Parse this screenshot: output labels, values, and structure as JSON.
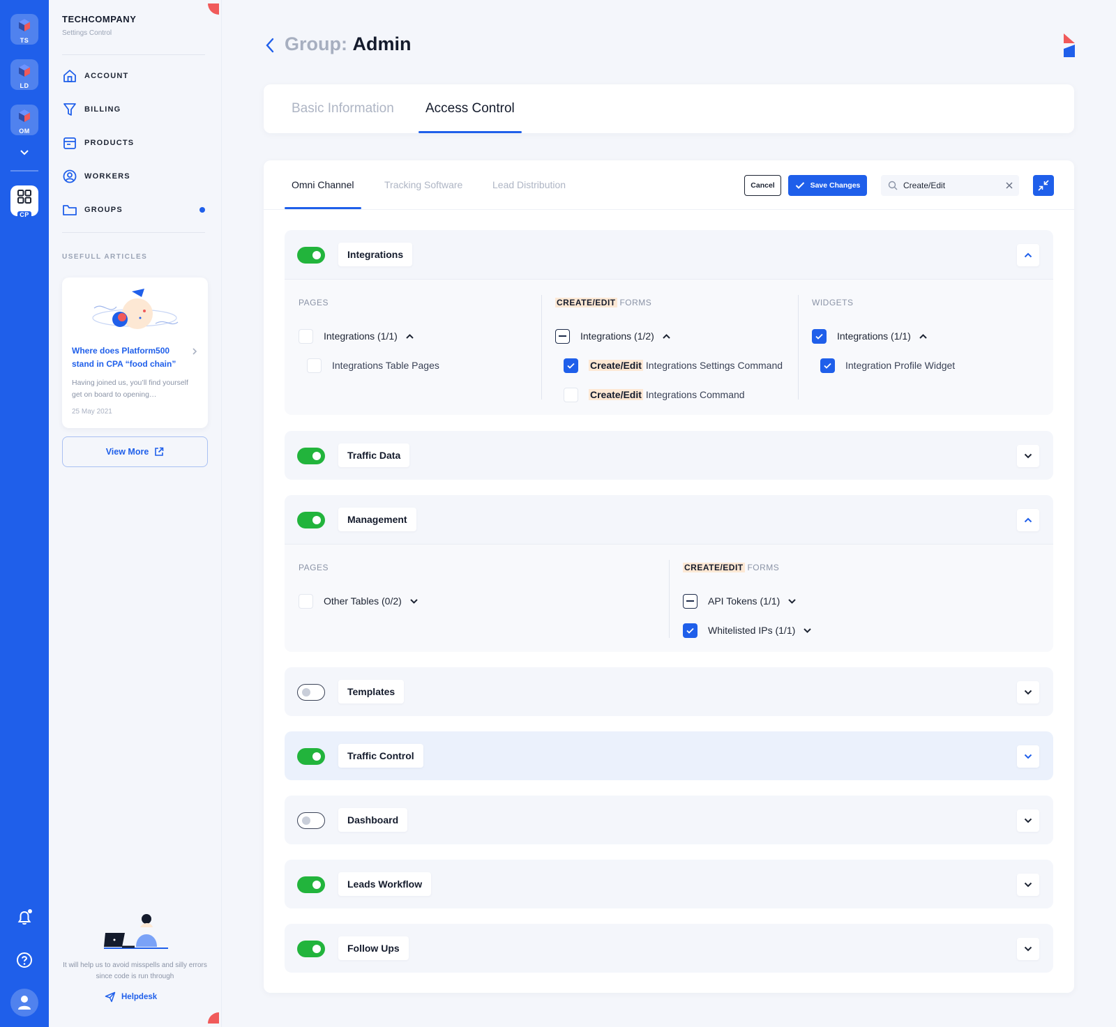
{
  "rail": {
    "apps": [
      {
        "label": "TS",
        "active": false
      },
      {
        "label": "LD",
        "active": false
      },
      {
        "label": "OM",
        "active": false
      },
      {
        "label": "CP",
        "active": true
      }
    ]
  },
  "sidebar": {
    "company": "TECHCOMPANY",
    "company_sub": "Settings Control",
    "nav": [
      {
        "label": "ACCOUNT",
        "icon": "home-icon"
      },
      {
        "label": "BILLING",
        "icon": "filter-icon"
      },
      {
        "label": "PRODUCTS",
        "icon": "box-icon"
      },
      {
        "label": "WORKERS",
        "icon": "user-circle-icon"
      },
      {
        "label": "GROUPS",
        "icon": "folder-icon"
      }
    ],
    "articles_title": "USEFULL ARTICLES",
    "article": {
      "title": "Where does Platform500 stand in CPA “food chain”",
      "text": "Having joined us, you’ll find yourself get on board to opening…",
      "date": "25 May 2021"
    },
    "view_more": "View More",
    "helpdesk_text": "It will help us to avoid misspells and silly errors since code is run through",
    "helpdesk_link": "Helpdesk"
  },
  "header": {
    "title_prefix": "Group:",
    "title_name": "Admin"
  },
  "top_tabs": [
    "Basic Information",
    "Access Control"
  ],
  "sub_tabs": [
    "Omni Channel",
    "Tracking Software",
    "Lead Distribution"
  ],
  "toolbar": {
    "cancel": "Cancel",
    "save": "Save Changes",
    "search_value": "Create/Edit"
  },
  "col_titles": {
    "pages": "PAGES",
    "create_edit": "CREATE/EDIT",
    "forms": " FORMS",
    "widgets": "WIDGETS"
  },
  "sections": [
    {
      "name": "Integrations",
      "enabled": true,
      "expanded": true
    },
    {
      "name": "Traffic Data",
      "enabled": true,
      "expanded": false
    },
    {
      "name": "Management",
      "enabled": true,
      "expanded": true
    },
    {
      "name": "Templates",
      "enabled": false,
      "expanded": false
    },
    {
      "name": "Traffic Control",
      "enabled": true,
      "expanded": false
    },
    {
      "name": "Dashboard",
      "enabled": false,
      "expanded": false
    },
    {
      "name": "Leads Workflow",
      "enabled": true,
      "expanded": false
    },
    {
      "name": "Follow Ups",
      "enabled": true,
      "expanded": false
    }
  ],
  "integrations": {
    "pages_group": "Integrations (1/1)",
    "pages_item": "Integrations Table Pages",
    "forms_group": "Integrations (1/2)",
    "forms_item1_hl": "Create/Edit",
    "forms_item1": "Integrations Settings Command",
    "forms_item2_hl": "Create/Edit",
    "forms_item2": "Integrations Command",
    "widgets_group": "Integrations (1/1)",
    "widgets_item": "Integration Profile Widget"
  },
  "management": {
    "pages_group": "Other Tables (0/2)",
    "forms_group1": "API Tokens (1/1)",
    "forms_group2": "Whitelisted IPs (1/1)"
  },
  "colors": {
    "primary": "#1f5fea",
    "toggle_on": "#22b43c",
    "highlight": "#fde8d4",
    "accent_red": "#f05a5a"
  }
}
